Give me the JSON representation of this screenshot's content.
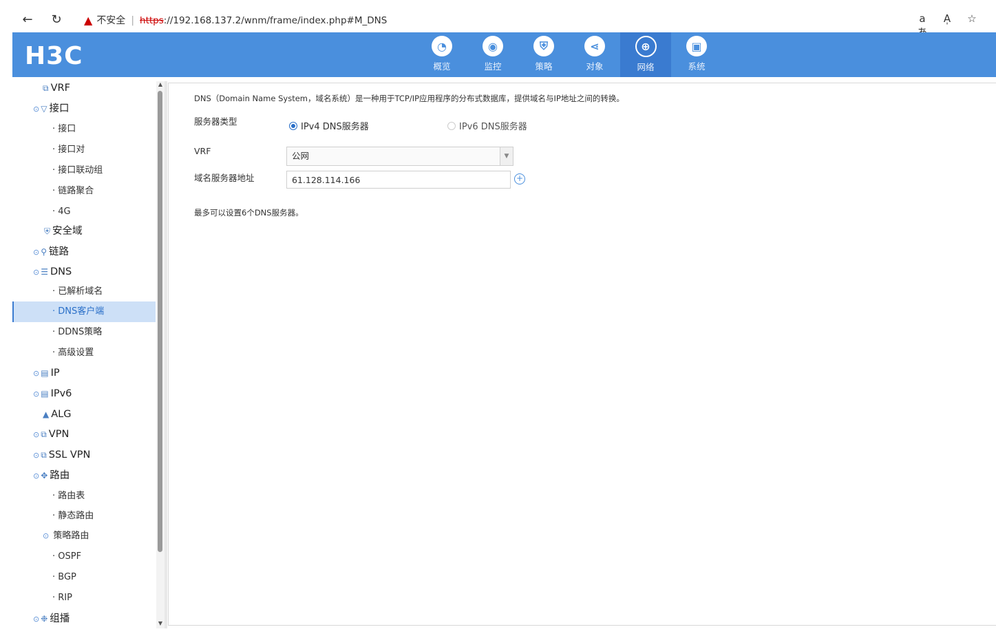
{
  "browser": {
    "security_label": "不安全",
    "url_scheme": "https",
    "url_rest": "://192.168.137.2/wnm/frame/index.php#M_DNS",
    "translate_icon": "aあ",
    "read_icon": "A̩",
    "star_icon": "☆"
  },
  "brand": {
    "logo": "H3C",
    "accent": "#4a8fdd"
  },
  "topnav": {
    "items": [
      {
        "label": "概览",
        "icon": "gauge-icon"
      },
      {
        "label": "监控",
        "icon": "camera-icon"
      },
      {
        "label": "策略",
        "icon": "shield-icon"
      },
      {
        "label": "对象",
        "icon": "share-icon"
      },
      {
        "label": "网络",
        "icon": "globe-icon",
        "active": true
      },
      {
        "label": "系统",
        "icon": "monitor-icon"
      }
    ]
  },
  "sidebar": {
    "items": [
      {
        "label": "VRF"
      },
      {
        "label": "接口"
      },
      {
        "label": "· 接口"
      },
      {
        "label": "· 接口对"
      },
      {
        "label": "· 接口联动组"
      },
      {
        "label": "· 链路聚合"
      },
      {
        "label": "· 4G"
      },
      {
        "label": "安全域"
      },
      {
        "label": "链路"
      },
      {
        "label": "DNS"
      },
      {
        "label": "· 已解析域名"
      },
      {
        "label": "· DNS客户端",
        "selected": true
      },
      {
        "label": "· DDNS策略"
      },
      {
        "label": "· 高级设置"
      },
      {
        "label": "IP"
      },
      {
        "label": "IPv6"
      },
      {
        "label": "ALG"
      },
      {
        "label": "VPN"
      },
      {
        "label": "SSL VPN"
      },
      {
        "label": "路由"
      },
      {
        "label": "· 路由表"
      },
      {
        "label": "· 静态路由"
      },
      {
        "label": "策略路由"
      },
      {
        "label": "· OSPF"
      },
      {
        "label": "· BGP"
      },
      {
        "label": "· RIP"
      },
      {
        "label": "组播"
      }
    ]
  },
  "content": {
    "description": "DNS（Domain Name System，域名系统）是一种用于TCP/IP应用程序的分布式数据库，提供域名与IP地址之间的转换。",
    "server_type_label": "服务器类型",
    "ipv4_option": "IPv4 DNS服务器",
    "ipv6_option": "IPv6 DNS服务器",
    "vrf_label": "VRF",
    "vrf_value": "公网",
    "dns_address_label": "域名服务器地址",
    "dns_address_value": "61.128.114.166",
    "note": "最多可以设置6个DNS服务器。"
  }
}
